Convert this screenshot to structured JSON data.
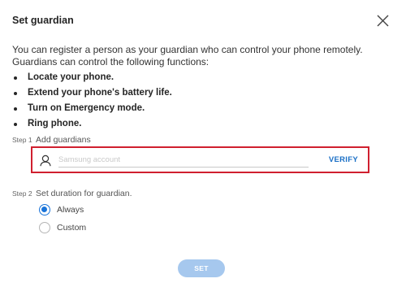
{
  "dialog": {
    "title": "Set guardian",
    "intro_line1": "You can register a person as your guardian who can control your phone remotely.",
    "intro_line2": "Guardians can control the following functions:",
    "functions": [
      "Locate your phone.",
      "Extend your phone's battery life.",
      "Turn on Emergency mode.",
      "Ring phone."
    ]
  },
  "step1": {
    "number": "Step 1",
    "label": "Add guardians",
    "input_placeholder": "Samsung account",
    "input_value": "",
    "verify_label": "VERIFY"
  },
  "step2": {
    "number": "Step 2",
    "label": "Set duration for guardian.",
    "options": [
      {
        "label": "Always",
        "selected": true
      },
      {
        "label": "Custom",
        "selected": false
      }
    ]
  },
  "footer": {
    "set_label": "SET"
  },
  "colors": {
    "accent": "#1a74d9",
    "highlight_border": "#d0202f",
    "set_button_disabled": "#a6c8ee"
  }
}
